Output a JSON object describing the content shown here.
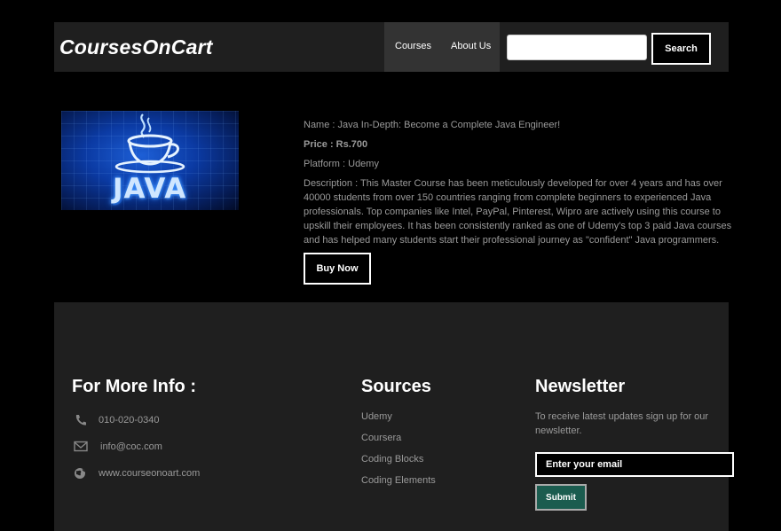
{
  "header": {
    "logo": "CoursesOnCart",
    "nav": [
      {
        "label": "Courses"
      },
      {
        "label": "About Us"
      }
    ],
    "search": {
      "placeholder": "",
      "button": "Search"
    }
  },
  "product": {
    "image_icon": "java-logo-image",
    "image_text": "JAVA",
    "name": "Name : Java In-Depth: Become a Complete Java Engineer!",
    "price": "Price : Rs.700",
    "platform": "Platform : Udemy",
    "description": "Description : This Master Course has been meticulously developed for over 4 years and has over 40000 students from over 150 countries ranging from complete beginners to experienced Java professionals. Top companies like Intel, PayPal, Pinterest, Wipro are actively using this course to upskill their employees. It has been consistently ranked as one of Udemy's top 3 paid Java courses and has helped many students start their professional journey as \"confident\" Java programmers.",
    "buy_label": "Buy Now"
  },
  "footer": {
    "info": {
      "heading": "For More Info :",
      "phone": "010-020-0340",
      "email": "info@coc.com",
      "website": "www.courseonoart.com"
    },
    "sources": {
      "heading": "Sources",
      "items": [
        "Udemy",
        "Coursera",
        "Coding Blocks",
        "Coding Elements"
      ]
    },
    "newsletter": {
      "heading": "Newsletter",
      "text": "To receive latest updates sign up for our newsletter.",
      "placeholder": "Enter your email",
      "submit": "Submit"
    }
  },
  "colors": {
    "background": "#000000",
    "panel": "#1f1f1f",
    "nav_active": "#333333",
    "submit": "#1b5c4f"
  }
}
